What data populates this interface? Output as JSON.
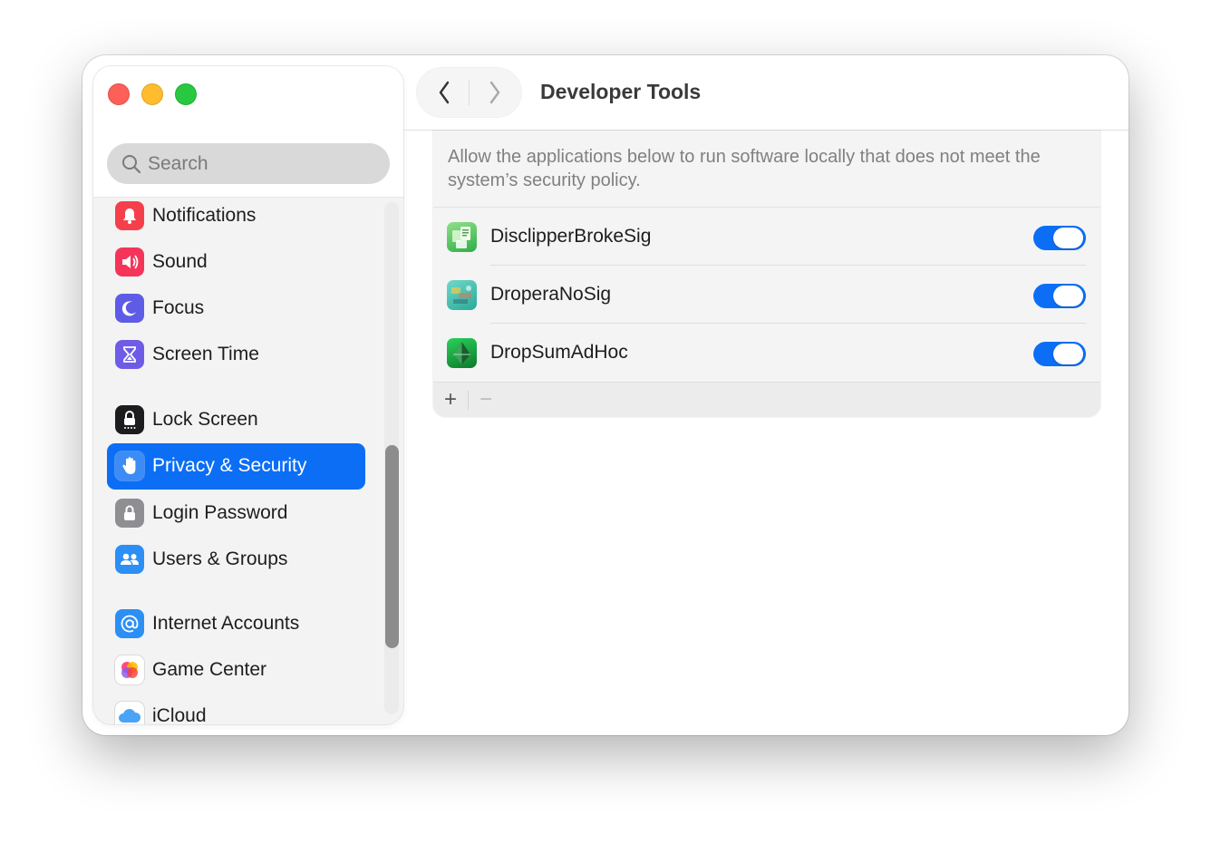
{
  "window": {
    "title": "Developer Tools",
    "accent_color": "#0b6ef5"
  },
  "toolbar": {
    "back_icon": "chevron-left-icon",
    "forward_icon": "chevron-right-icon"
  },
  "search": {
    "placeholder": "Search"
  },
  "sidebar": {
    "items": [
      {
        "label": "Notifications",
        "icon": "bell-icon",
        "color": "#f5404c"
      },
      {
        "label": "Sound",
        "icon": "speaker-icon",
        "color": "#f5345a"
      },
      {
        "label": "Focus",
        "icon": "moon-icon",
        "color": "#5e5ce6"
      },
      {
        "label": "Screen Time",
        "icon": "hourglass-icon",
        "color": "#6e5ce6"
      },
      {
        "label": "Lock Screen",
        "icon": "lock-screen-icon",
        "color": "#1c1c1e"
      },
      {
        "label": "Privacy & Security",
        "icon": "hand-icon",
        "color": "#3d8cf5",
        "selected": true
      },
      {
        "label": "Login Password",
        "icon": "lock-icon",
        "color": "#8e8e93"
      },
      {
        "label": "Users & Groups",
        "icon": "users-icon",
        "color": "#2b8ff5"
      },
      {
        "label": "Internet Accounts",
        "icon": "at-icon",
        "color": "#2b8ff5"
      },
      {
        "label": "Game Center",
        "icon": "game-center-icon",
        "color": "#ffffff"
      },
      {
        "label": "iCloud",
        "icon": "cloud-icon",
        "color": "#ffffff"
      }
    ]
  },
  "main": {
    "description": "Allow the applications below to run software locally that does not meet the system’s security policy.",
    "apps": [
      {
        "name": "DisclipperBrokeSig",
        "icon": "app-icon-disclipper",
        "enabled": true
      },
      {
        "name": "DroperaNoSig",
        "icon": "app-icon-dropera",
        "enabled": true
      },
      {
        "name": "DropSumAdHoc",
        "icon": "app-icon-dropsum",
        "enabled": true
      }
    ],
    "add_label": "+",
    "remove_label": "−"
  }
}
